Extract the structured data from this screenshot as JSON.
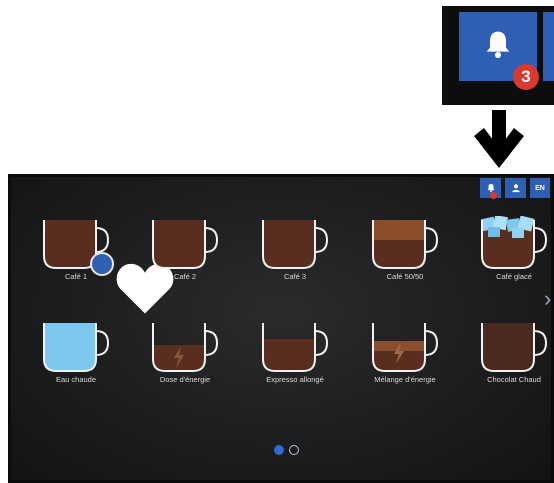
{
  "callout": {
    "notification_count": "3",
    "icon": "bell-icon",
    "arrow_icon": "down-arrow-icon"
  },
  "header": {
    "lang_label": "EN",
    "notifications_icon": "bell-icon",
    "profile_icon": "user-icon"
  },
  "drinks": [
    {
      "label": "Café 1",
      "fill": "full",
      "color": "#5a2e1f",
      "favorite": true
    },
    {
      "label": "Café 2",
      "fill": "full",
      "color": "#5a2e1f"
    },
    {
      "label": "Café 3",
      "fill": "full",
      "color": "#5a2e1f"
    },
    {
      "label": "Café 50/50",
      "fill": "two-tone",
      "color": "#8a4e2c"
    },
    {
      "label": "Café glacé",
      "fill": "iced",
      "color": "#5a2e1f"
    },
    {
      "label": "Eau chaude",
      "fill": "water",
      "color": "#7ec8f0"
    },
    {
      "label": "Dose d'énergie",
      "fill": "low-energy",
      "color": "#5a2e1f"
    },
    {
      "label": "Expresso allongé",
      "fill": "half",
      "color": "#5a2e1f"
    },
    {
      "label": "Mélange d'énergie",
      "fill": "half-energy",
      "color": "#8a4e2c"
    },
    {
      "label": "Chocolat Chaud",
      "fill": "full",
      "color": "#4a2a20"
    }
  ],
  "pagination": {
    "pages": 2,
    "current": 1
  },
  "colors": {
    "accent": "#2f5fb3",
    "badge": "#d83a2f",
    "coffee": "#5a2e1f"
  }
}
